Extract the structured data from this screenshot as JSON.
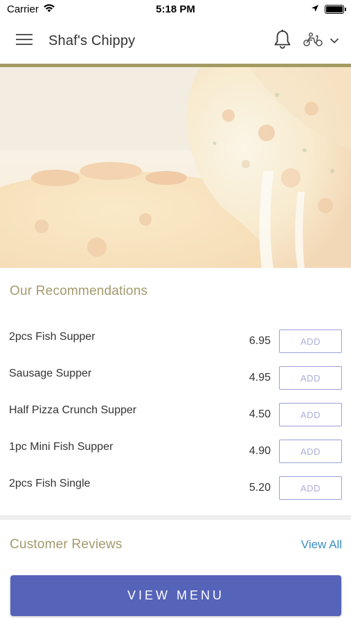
{
  "status_bar": {
    "carrier": "Carrier",
    "time": "5:18 PM",
    "wifi_icon": "wifi-icon",
    "location_icon": "location-arrow-icon",
    "battery_icon": "battery-icon"
  },
  "header": {
    "title": "Shaf's Chippy",
    "menu_icon": "hamburger-menu-icon",
    "notification_icon": "bell-icon",
    "delivery_icon": "scooter-icon",
    "dropdown_icon": "chevron-down-icon"
  },
  "hero": {
    "image": "cheese pizza slice"
  },
  "recommendations": {
    "title": "Our Recommendations",
    "add_label": "ADD",
    "items": [
      {
        "name": "2pcs Fish Supper",
        "price": "6.95"
      },
      {
        "name": "Sausage Supper",
        "price": "4.95"
      },
      {
        "name": "Half Pizza Crunch Supper",
        "price": "4.50"
      },
      {
        "name": "1pc Mini Fish Supper",
        "price": "4.90"
      },
      {
        "name": "2pcs Fish Single",
        "price": "5.20"
      }
    ]
  },
  "reviews": {
    "title": "Customer Reviews",
    "view_all": "View All"
  },
  "cta": {
    "view_menu": "VIEW MENU"
  },
  "colors": {
    "accent_gold": "#a39b62",
    "section_title": "#a49a6d",
    "primary_button": "#5563b9",
    "add_border": "#9aa0d8",
    "link": "#3a8fc3"
  }
}
